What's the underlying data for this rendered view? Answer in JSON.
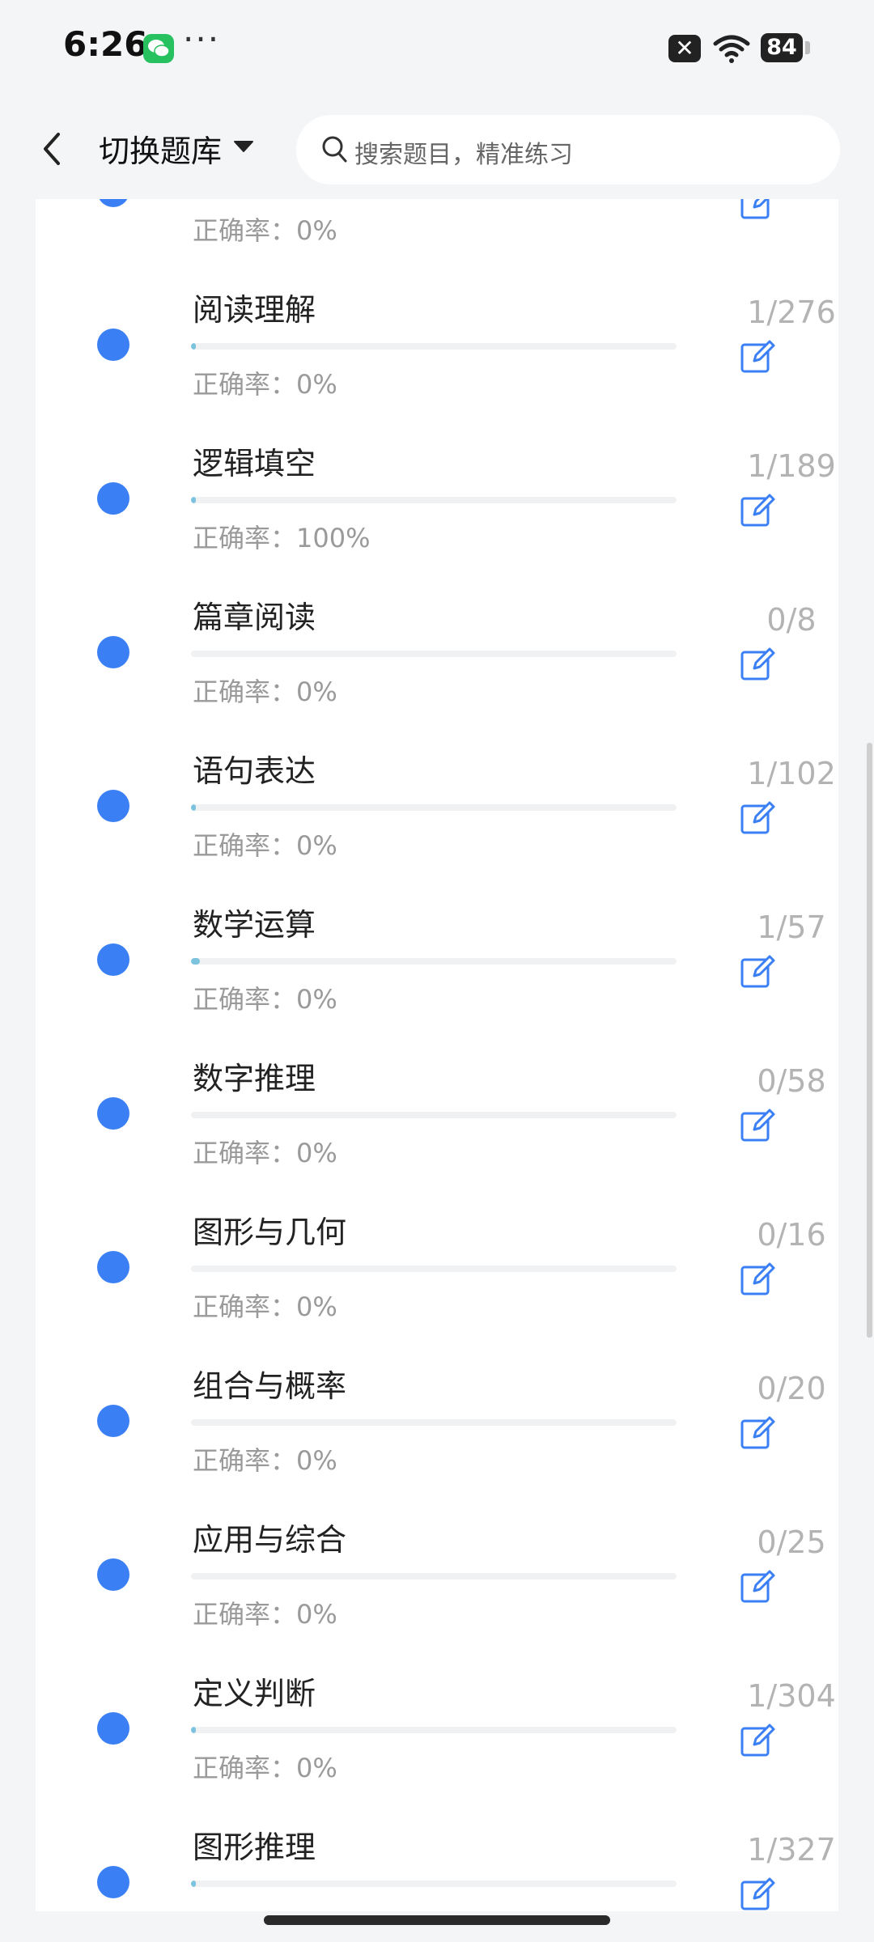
{
  "status_bar": {
    "time": "6:26",
    "more": "···",
    "notification_icon": "x-icon",
    "battery": "84"
  },
  "header": {
    "title": "切换题库",
    "search_placeholder": "搜索题目，精准练习"
  },
  "items": [
    {
      "title": "",
      "accuracy": "正确率：0%",
      "count": "",
      "progress": 0
    },
    {
      "title": "阅读理解",
      "accuracy": "正确率：0%",
      "count": "1/276",
      "progress": 0.0036
    },
    {
      "title": "逻辑填空",
      "accuracy": "正确率：100%",
      "count": "1/189",
      "progress": 0.0053
    },
    {
      "title": "篇章阅读",
      "accuracy": "正确率：0%",
      "count": "0/8",
      "progress": 0
    },
    {
      "title": "语句表达",
      "accuracy": "正确率：0%",
      "count": "1/102",
      "progress": 0.0098
    },
    {
      "title": "数学运算",
      "accuracy": "正确率：0%",
      "count": "1/57",
      "progress": 0.0175
    },
    {
      "title": "数字推理",
      "accuracy": "正确率：0%",
      "count": "0/58",
      "progress": 0
    },
    {
      "title": "图形与几何",
      "accuracy": "正确率：0%",
      "count": "0/16",
      "progress": 0
    },
    {
      "title": "组合与概率",
      "accuracy": "正确率：0%",
      "count": "0/20",
      "progress": 0
    },
    {
      "title": "应用与综合",
      "accuracy": "正确率：0%",
      "count": "0/25",
      "progress": 0
    },
    {
      "title": "定义判断",
      "accuracy": "正确率：0%",
      "count": "1/304",
      "progress": 0.0033
    },
    {
      "title": "图形推理",
      "accuracy": "",
      "count": "1/327",
      "progress": 0.0031
    }
  ],
  "colors": {
    "accent": "#3b7ff5",
    "progress": "#7cc3de",
    "muted": "#9a9a9a"
  }
}
